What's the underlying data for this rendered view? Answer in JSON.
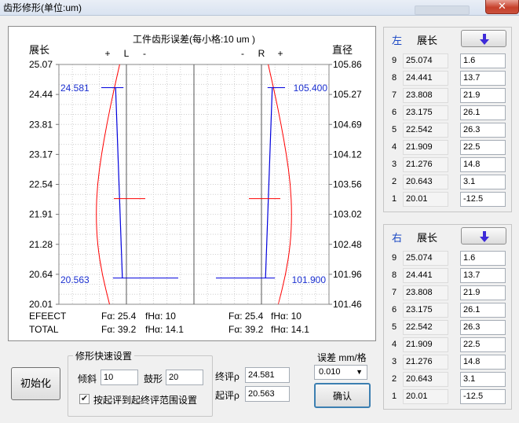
{
  "window": {
    "title": "齿形修形(单位:um)",
    "close_glyph": "✕"
  },
  "chart": {
    "title": "工件齿形误差(每小格:10 um )",
    "left_axis_label": "展长",
    "right_axis_label": "直径",
    "left_ticks": [
      "25.07",
      "24.44",
      "23.81",
      "23.17",
      "22.54",
      "21.91",
      "21.28",
      "20.64",
      "20.01"
    ],
    "right_ticks": [
      "105.86",
      "105.27",
      "104.69",
      "104.12",
      "103.56",
      "103.02",
      "102.48",
      "101.96",
      "101.46"
    ],
    "left_marks": [
      "+",
      "L",
      "-"
    ],
    "right_marks": [
      "-",
      "R",
      "+"
    ],
    "top_value_left": "24.581",
    "top_value_right": "105.400",
    "bottom_value_left": "20.563",
    "bottom_value_right": "101.900",
    "footer": {
      "effect_label": "EFEECT",
      "total_label": "TOTAL",
      "left_fa_effect": "Fα: 25.4",
      "left_fha_effect": "fHα: 10",
      "left_fa_total": "Fα: 39.2",
      "left_fha_total": "fHα: 14.1",
      "right_fa_effect": "Fα: 25.4",
      "right_fha_effect": "fHα: 10",
      "right_fa_total": "Fα: 39.2",
      "right_fha_total": "fHα: 14.1"
    }
  },
  "chart_data": {
    "type": "line",
    "y_range": [
      20.01,
      25.07
    ],
    "x_range": [
      -100,
      100
    ],
    "eval_start": 24.581,
    "eval_end": 20.563,
    "left_profile": {
      "points": [
        [
          -10,
          25.07
        ],
        [
          -20,
          24.44
        ],
        [
          -29,
          23.81
        ],
        [
          -37,
          23.17
        ],
        [
          -43,
          22.54
        ],
        [
          -45,
          21.91
        ],
        [
          -43,
          21.28
        ],
        [
          -36,
          20.64
        ],
        [
          -25,
          20.01
        ]
      ],
      "line_top_x": -16,
      "line_bottom_x": -6,
      "mid_mark_y": 22.24
    },
    "right_profile": {
      "points": [
        [
          10,
          25.07
        ],
        [
          20,
          24.44
        ],
        [
          29,
          23.81
        ],
        [
          37,
          23.17
        ],
        [
          43,
          22.54
        ],
        [
          45,
          21.91
        ],
        [
          43,
          21.28
        ],
        [
          36,
          20.64
        ],
        [
          25,
          20.01
        ]
      ],
      "line_top_x": 16,
      "line_bottom_x": 6,
      "mid_mark_y": 22.24
    }
  },
  "left_panel": {
    "side": "左",
    "title": "展长",
    "rows": [
      {
        "idx": "9",
        "pos": "25.074",
        "err": "1.6"
      },
      {
        "idx": "8",
        "pos": "24.441",
        "err": "13.7"
      },
      {
        "idx": "7",
        "pos": "23.808",
        "err": "21.9"
      },
      {
        "idx": "6",
        "pos": "23.175",
        "err": "26.1"
      },
      {
        "idx": "5",
        "pos": "22.542",
        "err": "26.3"
      },
      {
        "idx": "4",
        "pos": "21.909",
        "err": "22.5"
      },
      {
        "idx": "3",
        "pos": "21.276",
        "err": "14.8"
      },
      {
        "idx": "2",
        "pos": "20.643",
        "err": "3.1"
      },
      {
        "idx": "1",
        "pos": "20.01",
        "err": "-12.5"
      }
    ]
  },
  "right_panel": {
    "side": "右",
    "title": "展长",
    "rows": [
      {
        "idx": "9",
        "pos": "25.074",
        "err": "1.6"
      },
      {
        "idx": "8",
        "pos": "24.441",
        "err": "13.7"
      },
      {
        "idx": "7",
        "pos": "23.808",
        "err": "21.9"
      },
      {
        "idx": "6",
        "pos": "23.175",
        "err": "26.1"
      },
      {
        "idx": "5",
        "pos": "22.542",
        "err": "26.3"
      },
      {
        "idx": "4",
        "pos": "21.909",
        "err": "22.5"
      },
      {
        "idx": "3",
        "pos": "21.276",
        "err": "14.8"
      },
      {
        "idx": "2",
        "pos": "20.643",
        "err": "3.1"
      },
      {
        "idx": "1",
        "pos": "20.01",
        "err": "-12.5"
      }
    ]
  },
  "controls": {
    "init_button": "初始化",
    "group_title": "修形快速设置",
    "slope_label": "倾斜",
    "slope_value": "10",
    "drum_label": "鼓形",
    "drum_value": "20",
    "range_checkbox_label": "按起评到起终评范围设置",
    "range_checked": true,
    "end_eval_label": "终评ρ",
    "end_eval_value": "24.581",
    "start_eval_label": "起评ρ",
    "start_eval_value": "20.563",
    "error_label": "误差 mm/格",
    "error_value": "0.010",
    "confirm_button": "确认"
  },
  "colors": {
    "profile_red": "#ff0000",
    "profile_blue": "#0000dd",
    "grid": "#c8c8c8",
    "value_blue": "#1a2fd0",
    "side_blue": "#1a48c4"
  }
}
